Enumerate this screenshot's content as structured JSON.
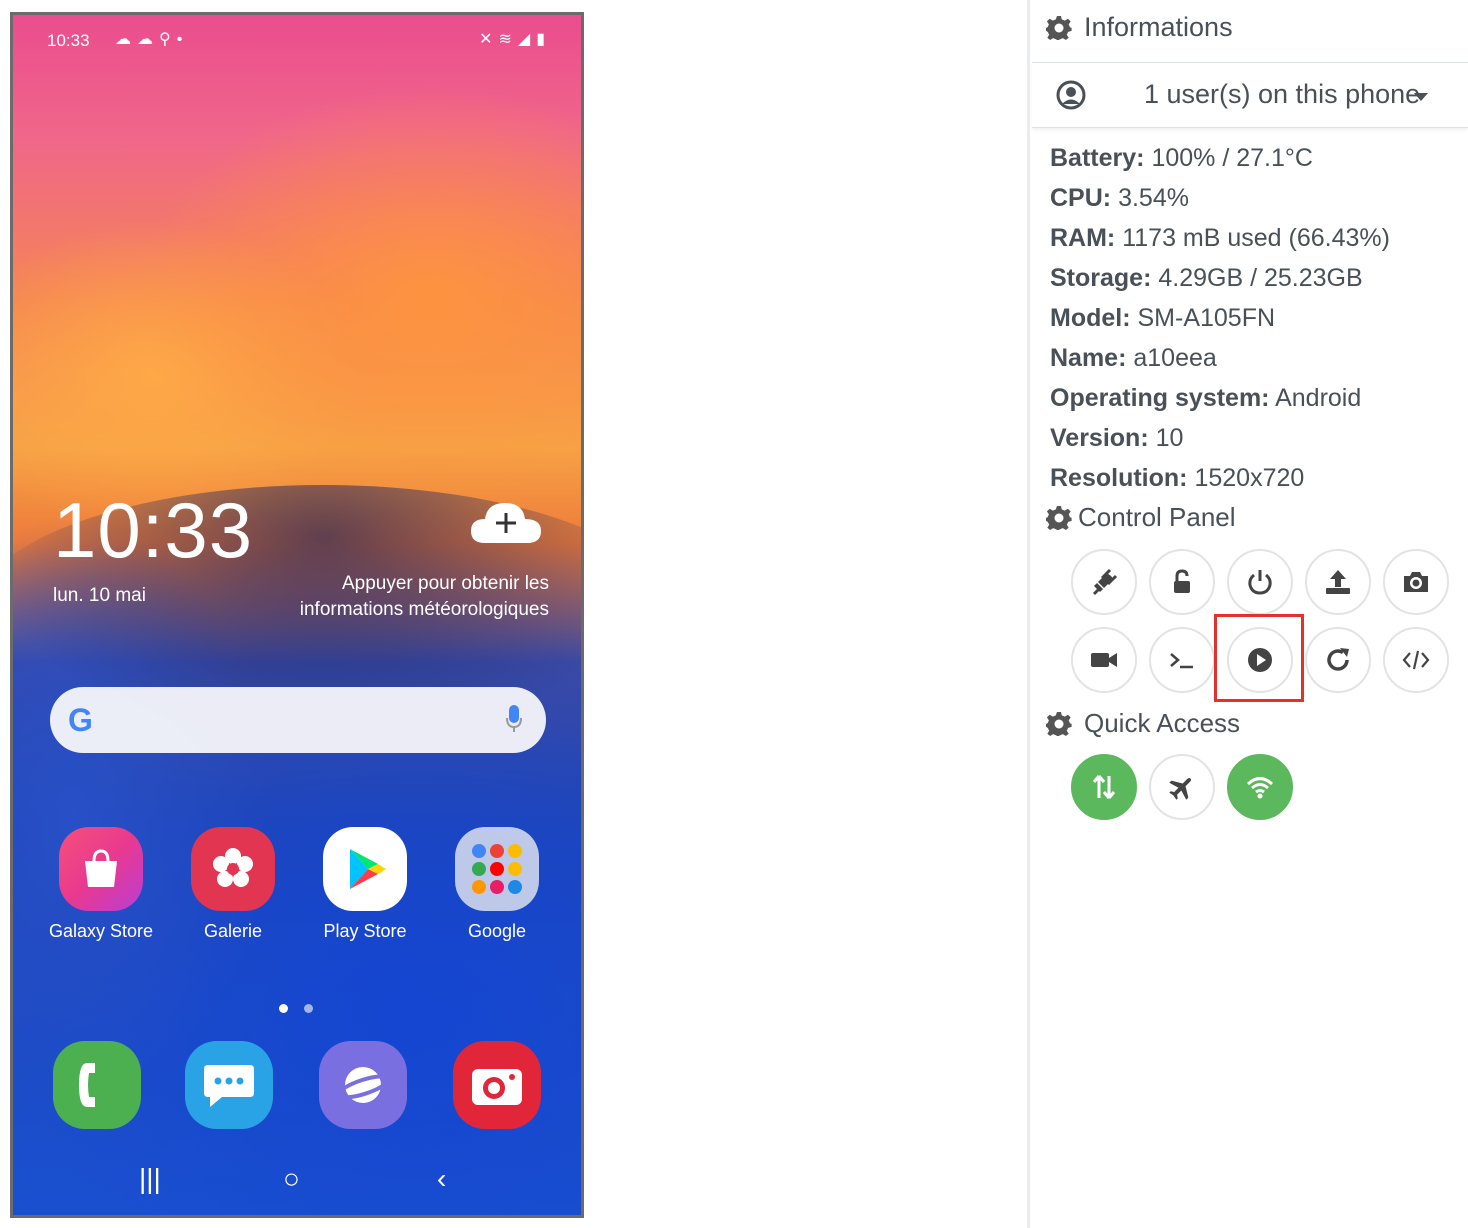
{
  "phone": {
    "status_time": "10:33",
    "clock": "10:33",
    "date": "lun. 10 mai",
    "weather_prompt_line1": "Appuyer pour obtenir les",
    "weather_prompt_line2": "informations météorologiques",
    "apps": [
      {
        "label": "Galaxy Store",
        "icon": "bag-icon"
      },
      {
        "label": "Galerie",
        "icon": "flower-icon"
      },
      {
        "label": "Play Store",
        "icon": "play-store-icon"
      },
      {
        "label": "Google",
        "icon": "folder-icon"
      }
    ],
    "dock": [
      "phone-icon",
      "messages-icon",
      "internet-icon",
      "camera-icon"
    ]
  },
  "panel": {
    "informations_title": "Informations",
    "users_label": "1 user(s) on this phone",
    "info": {
      "battery_label": "Battery:",
      "battery_value": "100% / 27.1°C",
      "cpu_label": "CPU:",
      "cpu_value": "3.54%",
      "ram_label": "RAM:",
      "ram_value": "1173 mB used (66.43%)",
      "storage_label": "Storage:",
      "storage_value": "4.29GB / 25.23GB",
      "model_label": "Model:",
      "model_value": "SM-A105FN",
      "name_label": "Name:",
      "name_value": "a10eea",
      "os_label": "Operating system:",
      "os_value": "Android",
      "version_label": "Version:",
      "version_value": "10",
      "resolution_label": "Resolution:",
      "resolution_value": "1520x720"
    },
    "control_panel_title": "Control Panel",
    "control_buttons": [
      "plug-icon",
      "unlock-icon",
      "power-icon",
      "upload-icon",
      "camera-icon",
      "video-icon",
      "terminal-icon",
      "play-circle-icon",
      "redo-icon",
      "code-icon"
    ],
    "quick_access_title": "Quick Access",
    "quick_buttons": [
      "data-transfer-icon",
      "airplane-icon",
      "wifi-icon"
    ],
    "active_color": "#5cb85c",
    "highlight_color": "#e3312b"
  }
}
